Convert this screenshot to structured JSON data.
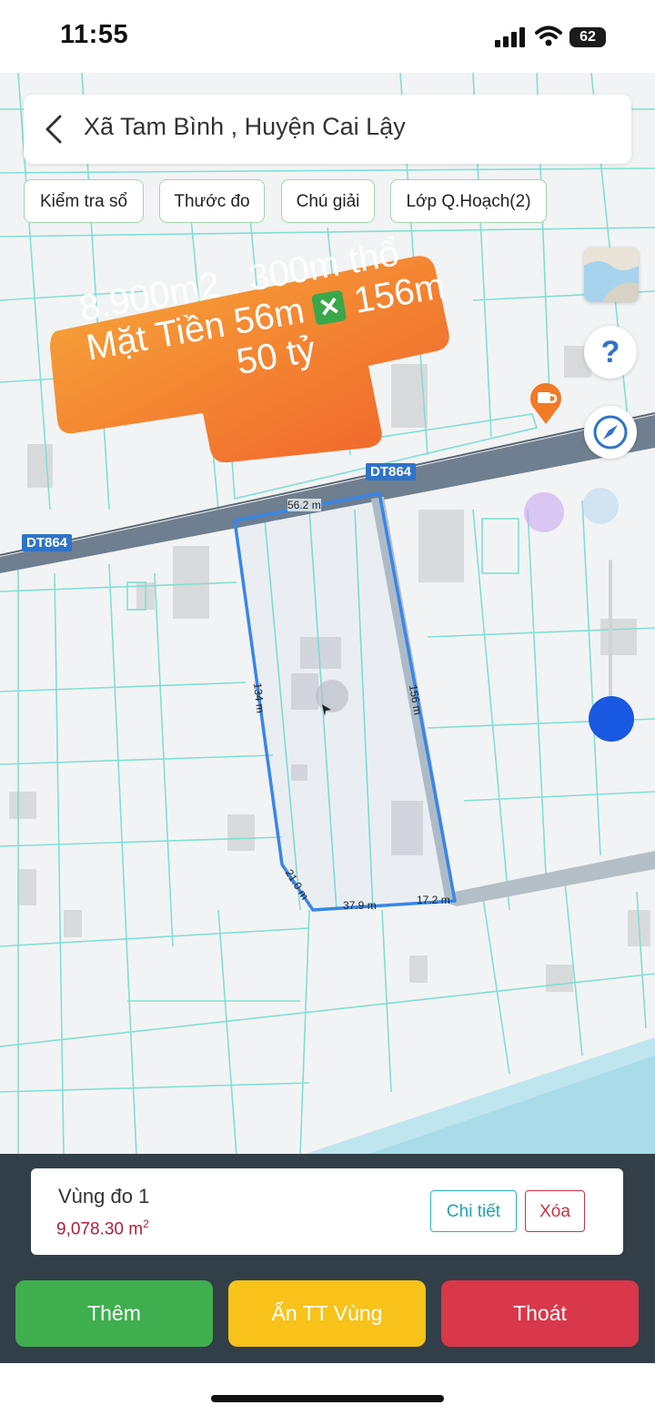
{
  "status_bar": {
    "time": "11:55",
    "battery": "62"
  },
  "header": {
    "title": "Xã Tam Bình , Huyện Cai Lậy"
  },
  "chips": [
    "Kiểm tra sổ",
    "Thước đo",
    "Chú giải",
    "Lớp Q.Hoạch(2)"
  ],
  "map": {
    "road_label": "DT864",
    "overlay": {
      "line1": "8.900m2 . 300m thổ",
      "line2a": "Mặt Tiền 56m",
      "line2b": "156m",
      "line3": "50 tỷ"
    },
    "measurements": [
      "56.2 m",
      "134 m",
      "156 m",
      "21.0 m",
      "37.9 m",
      "17.2 m"
    ],
    "help_glyph": "?"
  },
  "result": {
    "name": "Vùng đo 1",
    "area_value": "9,078.30 m",
    "area_sup": "2",
    "detail_label": "Chi tiết",
    "delete_label": "Xóa"
  },
  "actions": {
    "add": "Thêm",
    "hide": "Ẩn TT Vùng",
    "exit": "Thoát"
  },
  "colors": {
    "add": "#3fae4e",
    "hide": "#f7c21a",
    "exit": "#d9374a",
    "measure_line": "#3a86e6",
    "parcel": "#7fe0d2",
    "road": "#6f7f8f"
  }
}
